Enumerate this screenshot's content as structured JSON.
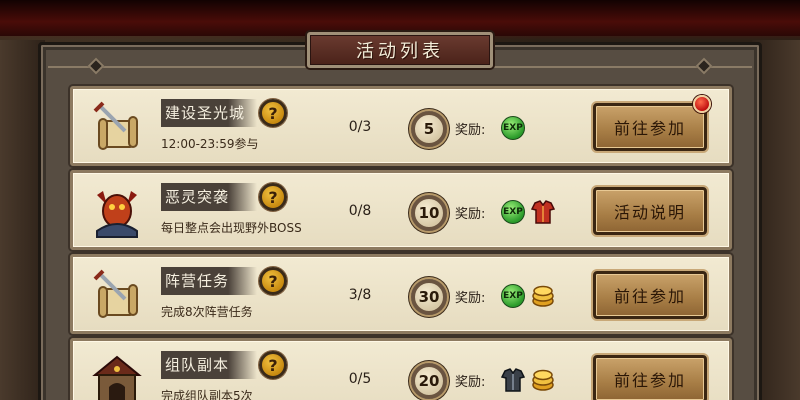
{
  "title": "活动列表",
  "reward_label": "奖励:",
  "exp_label": "EXP",
  "activities": [
    {
      "name": "建设圣光城",
      "desc": "12:00-23:59参与",
      "progress": "0/3",
      "points": "5",
      "icon": "scroll-sword-icon",
      "rewards": [
        "exp"
      ],
      "action": "前往参加",
      "notification": true
    },
    {
      "name": "恶灵突袭",
      "desc": "每日整点会出现野外BOSS",
      "progress": "0/8",
      "points": "10",
      "icon": "demon-boss-icon",
      "rewards": [
        "exp",
        "armor"
      ],
      "action": "活动说明",
      "notification": false
    },
    {
      "name": "阵营任务",
      "desc": "完成8次阵营任务",
      "progress": "3/8",
      "points": "30",
      "icon": "scroll-sword-icon",
      "rewards": [
        "exp",
        "gold"
      ],
      "action": "前往参加",
      "notification": false
    },
    {
      "name": "组队副本",
      "desc": "完成组队副本5次",
      "progress": "0/5",
      "points": "20",
      "icon": "dungeon-gate-icon",
      "rewards": [
        "armor-dark",
        "gold"
      ],
      "action": "前往参加",
      "notification": false
    }
  ],
  "colors": {
    "title_bg": "#5a2c22",
    "row_bg": "#f0e8d0",
    "button_bg": "#b08550",
    "exp_green": "#3aa83a"
  }
}
